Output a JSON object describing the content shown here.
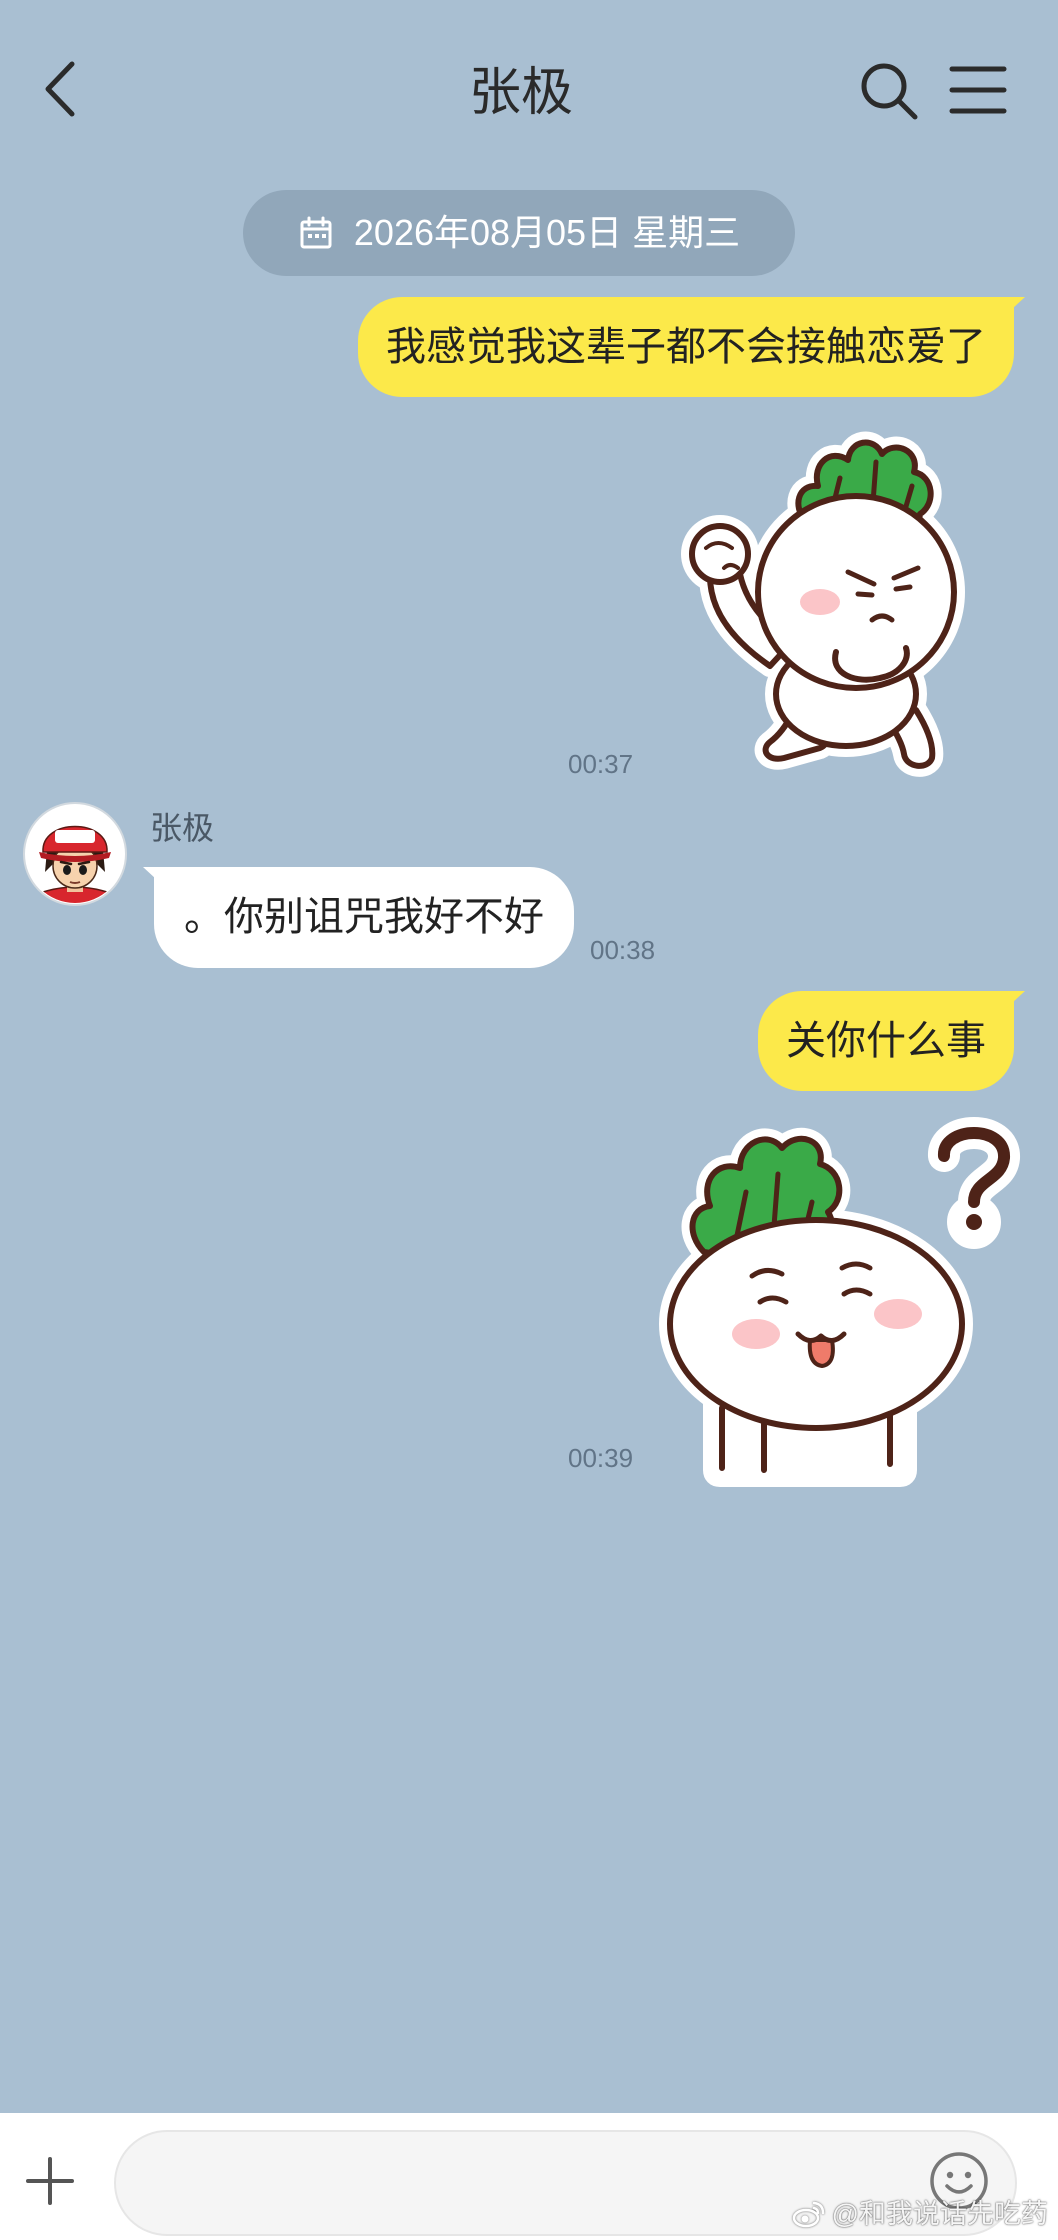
{
  "header": {
    "title": "张极",
    "icons": {
      "back": "chevron-left-icon",
      "search": "search-icon",
      "menu": "menu-icon"
    }
  },
  "date_divider": {
    "icon": "calendar-icon",
    "text": "2026年08月05日 星期三"
  },
  "messages": [
    {
      "direction": "outgoing",
      "kind": "text",
      "text": "我感觉我这辈子都不会接触恋爱了"
    },
    {
      "direction": "outgoing",
      "kind": "sticker",
      "sticker": "radish-flexing-sticker",
      "time": "00:37"
    },
    {
      "direction": "incoming",
      "kind": "text",
      "sender": "张极",
      "avatar": "cartoon-boy-red-cap-avatar",
      "text": "。你别诅咒我好不好",
      "time": "00:38"
    },
    {
      "direction": "outgoing",
      "kind": "text",
      "text": "关你什么事"
    },
    {
      "direction": "outgoing",
      "kind": "sticker",
      "sticker": "radish-question-sticker",
      "time": "00:39"
    }
  ],
  "input_bar": {
    "value": "",
    "icons": {
      "add": "plus-icon",
      "emoji": "smiley-icon"
    }
  },
  "watermark": {
    "icon": "weibo-logo-icon",
    "text": "@和我说话先吃药"
  },
  "colors": {
    "background": "#a9bfd2",
    "outgoing_bubble": "#fce94a",
    "incoming_bubble": "#ffffff",
    "date_pill": "#91a7ba",
    "timestamp": "#617487"
  }
}
